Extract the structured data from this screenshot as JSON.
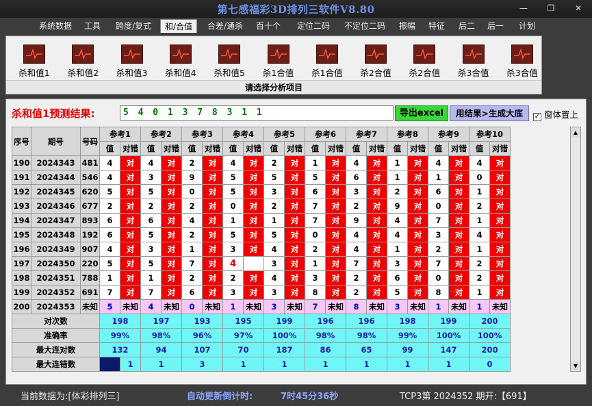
{
  "window": {
    "title": "第七感福彩3D排列三软件V8.80"
  },
  "menu": {
    "tabs": [
      "系统数据",
      "工具",
      "跨度/复式",
      "和/合值",
      "合差/通杀",
      "百十个",
      "定位二码",
      "不定位二码",
      "振幅",
      "特征",
      "后二",
      "后一",
      "计划"
    ],
    "active": "和/合值"
  },
  "ribbon": {
    "buttons": [
      "杀和值1",
      "杀和值2",
      "杀和值3",
      "杀和值4",
      "杀和值5",
      "杀1合值",
      "杀1合值",
      "杀2合值",
      "杀2合值",
      "杀3合值",
      "杀3合值"
    ],
    "caption": "请选择分析项目"
  },
  "prediction": {
    "label": "杀和值1预测结果:",
    "value": "5 4 0 1 3 7 8 3 1 1",
    "excel_label": "导出excel",
    "apply_label": "用结果>生成大底",
    "ontop_label": "窗体置上",
    "ontop_checked": "✓"
  },
  "table": {
    "headers": {
      "seq": "序号",
      "period": "期号",
      "code": "号码",
      "value": "值",
      "status": "对错"
    },
    "refs": [
      "参考1",
      "参考2",
      "参考3",
      "参考4",
      "参考5",
      "参考6",
      "参考7",
      "参考8",
      "参考9",
      "参考10"
    ],
    "rows": [
      {
        "seq": "190",
        "period": "2024343",
        "code": "481",
        "v": [
          "4",
          "4",
          "2",
          "4",
          "2",
          "1",
          "4",
          "1",
          "4",
          "4"
        ],
        "s": [
          "对",
          "对",
          "对",
          "对",
          "对",
          "对",
          "对",
          "对",
          "对",
          "对"
        ]
      },
      {
        "seq": "191",
        "period": "2024344",
        "code": "546",
        "v": [
          "4",
          "3",
          "9",
          "5",
          "5",
          "5",
          "6",
          "1",
          "1",
          "0"
        ],
        "s": [
          "对",
          "对",
          "对",
          "对",
          "对",
          "对",
          "对",
          "对",
          "对",
          "对"
        ]
      },
      {
        "seq": "192",
        "period": "2024345",
        "code": "620",
        "v": [
          "5",
          "5",
          "0",
          "5",
          "3",
          "6",
          "3",
          "2",
          "6",
          "1"
        ],
        "s": [
          "对",
          "对",
          "对",
          "对",
          "对",
          "对",
          "对",
          "对",
          "对",
          "对"
        ]
      },
      {
        "seq": "193",
        "period": "2024346",
        "code": "677",
        "v": [
          "2",
          "2",
          "2",
          "0",
          "2",
          "7",
          "2",
          "9",
          "0",
          "2"
        ],
        "s": [
          "对",
          "对",
          "对",
          "对",
          "对",
          "对",
          "对",
          "对",
          "对",
          "对"
        ]
      },
      {
        "seq": "194",
        "period": "2024347",
        "code": "893",
        "v": [
          "6",
          "6",
          "4",
          "1",
          "1",
          "7",
          "9",
          "4",
          "7",
          "1"
        ],
        "s": [
          "对",
          "对",
          "对",
          "对",
          "对",
          "对",
          "对",
          "对",
          "对",
          "对"
        ]
      },
      {
        "seq": "195",
        "period": "2024348",
        "code": "192",
        "v": [
          "6",
          "5",
          "2",
          "5",
          "5",
          "0",
          "4",
          "4",
          "3",
          "4"
        ],
        "s": [
          "对",
          "对",
          "对",
          "对",
          "对",
          "对",
          "对",
          "对",
          "对",
          "对"
        ]
      },
      {
        "seq": "196",
        "period": "2024349",
        "code": "907",
        "v": [
          "4",
          "3",
          "1",
          "3",
          "4",
          "2",
          "4",
          "1",
          "2",
          "1"
        ],
        "s": [
          "对",
          "对",
          "对",
          "对",
          "对",
          "对",
          "对",
          "对",
          "对",
          "对"
        ]
      },
      {
        "seq": "197",
        "period": "2024350",
        "code": "220",
        "v": [
          "5",
          "5",
          "7",
          "4",
          "3",
          "1",
          "7",
          "3",
          "7",
          "2"
        ],
        "s": [
          "对",
          "对",
          "对",
          "",
          "对",
          "对",
          "对",
          "对",
          "对",
          "对"
        ]
      },
      {
        "seq": "198",
        "period": "2024351",
        "code": "788",
        "v": [
          "1",
          "1",
          "2",
          "2",
          "4",
          "3",
          "2",
          "6",
          "0",
          "2"
        ],
        "s": [
          "对",
          "对",
          "对",
          "对",
          "对",
          "对",
          "对",
          "对",
          "对",
          "对"
        ]
      },
      {
        "seq": "199",
        "period": "2024352",
        "code": "691",
        "v": [
          "7",
          "7",
          "6",
          "3",
          "3",
          "8",
          "2",
          "5",
          "8",
          "1"
        ],
        "s": [
          "对",
          "对",
          "对",
          "对",
          "对",
          "对",
          "对",
          "对",
          "对",
          "对"
        ]
      }
    ],
    "next": {
      "seq": "200",
      "period": "2024353",
      "code": "未知",
      "v": [
        "5",
        "4",
        "0",
        "1",
        "3",
        "7",
        "8",
        "3",
        "1",
        "1"
      ],
      "s": [
        "未知",
        "未知",
        "未知",
        "未知",
        "未知",
        "未知",
        "未知",
        "未知",
        "未知",
        "未知"
      ]
    },
    "stats": [
      {
        "label": "对次数",
        "vals": [
          "198",
          "197",
          "193",
          "195",
          "199",
          "196",
          "196",
          "198",
          "199",
          "200"
        ]
      },
      {
        "label": "准确率",
        "vals": [
          "99%",
          "98%",
          "96%",
          "97%",
          "100%",
          "98%",
          "98%",
          "99%",
          "100%",
          "100%"
        ]
      },
      {
        "label": "最大连对数",
        "vals": [
          "132",
          "94",
          "107",
          "70",
          "187",
          "86",
          "65",
          "99",
          "147",
          "200"
        ]
      },
      {
        "label": "最大连错数",
        "vals": [
          "1",
          "1",
          "3",
          "1",
          "1",
          "1",
          "1",
          "1",
          "1",
          "0"
        ]
      }
    ]
  },
  "status": {
    "source": "当前数据为:[体彩排列三]",
    "countdown_label": "自动更新倒计时:",
    "countdown": "7时45分36秒",
    "latest": "TCP3第 2024352 期开:【691】"
  }
}
